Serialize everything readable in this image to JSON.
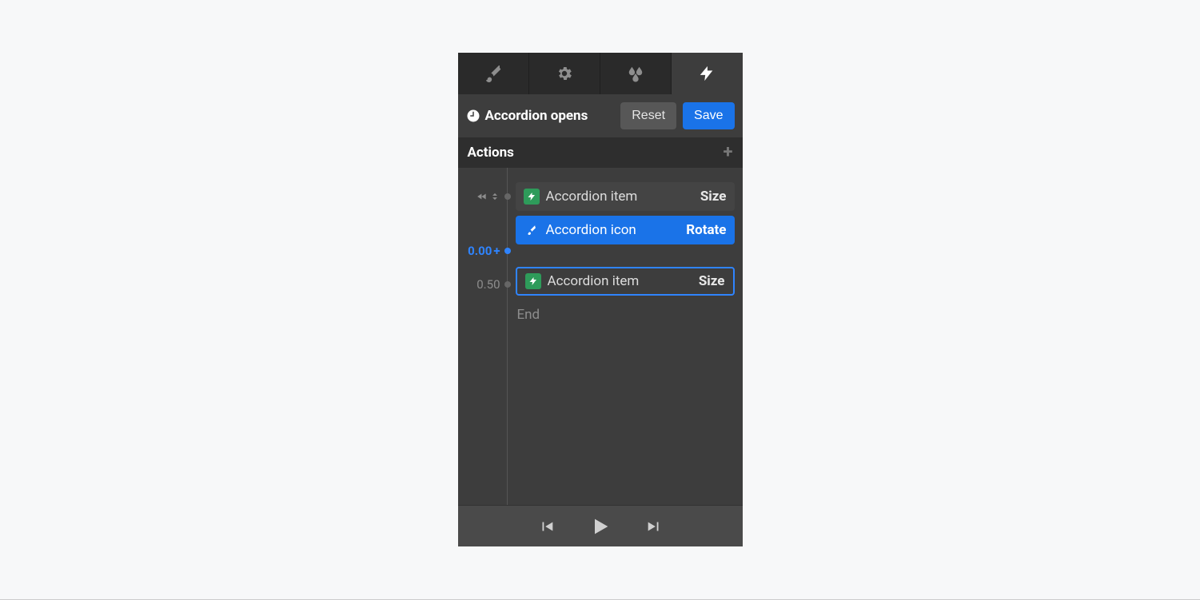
{
  "tabs": [
    "brush",
    "gear",
    "droplets",
    "bolt"
  ],
  "active_tab": 3,
  "title": "Accordion opens",
  "buttons": {
    "reset": "Reset",
    "save": "Save"
  },
  "actions_header": "Actions",
  "timeline": {
    "marks": [
      {
        "label": "",
        "type": "start"
      },
      {
        "label": "0.00",
        "type": "active"
      },
      {
        "label": "0.50",
        "type": "end"
      }
    ],
    "end_label": "End",
    "items": [
      {
        "badge": "bolt",
        "name": "Accordion item",
        "prop": "Size",
        "state": "normal"
      },
      {
        "badge": "brush",
        "name": "Accordion icon",
        "prop": "Rotate",
        "state": "selected"
      },
      {
        "badge": "bolt",
        "name": "Accordion item",
        "prop": "Size",
        "state": "outlined"
      }
    ]
  },
  "playback": [
    "prev",
    "play",
    "next"
  ]
}
